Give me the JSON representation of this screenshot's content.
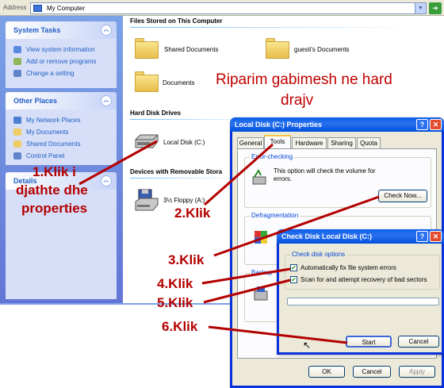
{
  "address": {
    "label": "Address",
    "value": "My Computer"
  },
  "left_pane": {
    "system_tasks": {
      "title": "System Tasks",
      "items": [
        {
          "label": "View system information",
          "icon": "info-icon"
        },
        {
          "label": "Add or remove programs",
          "icon": "programs-icon"
        },
        {
          "label": "Change a setting",
          "icon": "control-panel-icon"
        }
      ]
    },
    "other_places": {
      "title": "Other Places",
      "items": [
        {
          "label": "My Network Places",
          "icon": "network-icon"
        },
        {
          "label": "My Documents",
          "icon": "folder-icon"
        },
        {
          "label": "Shared Documents",
          "icon": "folder-icon"
        },
        {
          "label": "Control Panel",
          "icon": "control-panel-icon"
        }
      ]
    },
    "details": {
      "title": "Details"
    }
  },
  "content": {
    "files_section": "Files Stored on This Computer",
    "folders": [
      "Shared Documents",
      "guesti's Documents",
      "Documents"
    ],
    "hard_disk_section": "Hard Disk Drives",
    "local_disk": "Local Disk (C:)",
    "removable_section": "Devices with Removable Stora",
    "floppy": "3½ Floppy (A:)"
  },
  "overlay_title": {
    "line1": "Riparim gabimesh ne hard",
    "line2": "drajv"
  },
  "props_dialog": {
    "title": "Local Disk (C:) Properties",
    "tabs": [
      "General",
      "Tools",
      "Hardware",
      "Sharing",
      "Quota"
    ],
    "error_group": "Error-checking",
    "error_text": "This option will check the volume for errors.",
    "check_now": "Check Now...",
    "defrag_group": "Defragmentation",
    "backup_group": "Backup",
    "ok": "OK",
    "cancel": "Cancel",
    "apply": "Apply"
  },
  "check_dialog": {
    "title": "Check Disk Local Disk (C:)",
    "options_group": "Check disk options",
    "option1": "Automatically fix file system errors",
    "option2": "Scan for and attempt recovery of bad sectors",
    "start": "Start",
    "cancel": "Cancel"
  },
  "annotations": {
    "step1_line1": "1.Klik i",
    "step1_line2": "djathte dhe",
    "step1_line3": "properties",
    "step2": "2.Klik",
    "step3": "3.Klik",
    "step4": "4.Klik",
    "step5": "5.Klik",
    "step6": "6.Klik"
  },
  "colors": {
    "annotation": "#b30000",
    "title_overlay": "#c00000",
    "xp_blue": "#0831d9"
  }
}
